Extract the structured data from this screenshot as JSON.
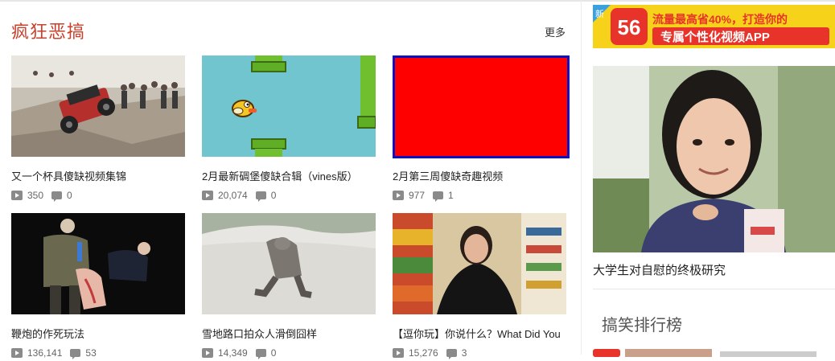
{
  "section": {
    "title": "疯狂恶搞",
    "more_label": "更多"
  },
  "videos": [
    {
      "title": "又一个杯具傻缺视频集锦",
      "plays": "350",
      "comments": "0"
    },
    {
      "title": "2月最新碉堡傻缺合辑（vines版）",
      "plays": "20,074",
      "comments": "0"
    },
    {
      "title": "2月第三周傻缺奇趣视频",
      "plays": "977",
      "comments": "1"
    },
    {
      "title": "鞭炮的作死玩法",
      "plays": "136,141",
      "comments": "53"
    },
    {
      "title": "雪地路口拍众人滑倒囧样",
      "plays": "14,349",
      "comments": "0"
    },
    {
      "title": "【逗你玩】你说什么？What Did You",
      "plays": "15,276",
      "comments": "3"
    }
  ],
  "sidebar": {
    "ad": {
      "badge": "新",
      "brand": "56",
      "line1": "流量最高省40%，打造你的",
      "line2": "专属个性化视频APP"
    },
    "feature_title": "大学生对自慰的终极研究",
    "ranking_title": "搞笑排行榜"
  },
  "colors": {
    "accent": "#c9402c",
    "ad_red": "#e8332a",
    "ad_yellow": "#f6d21a"
  }
}
